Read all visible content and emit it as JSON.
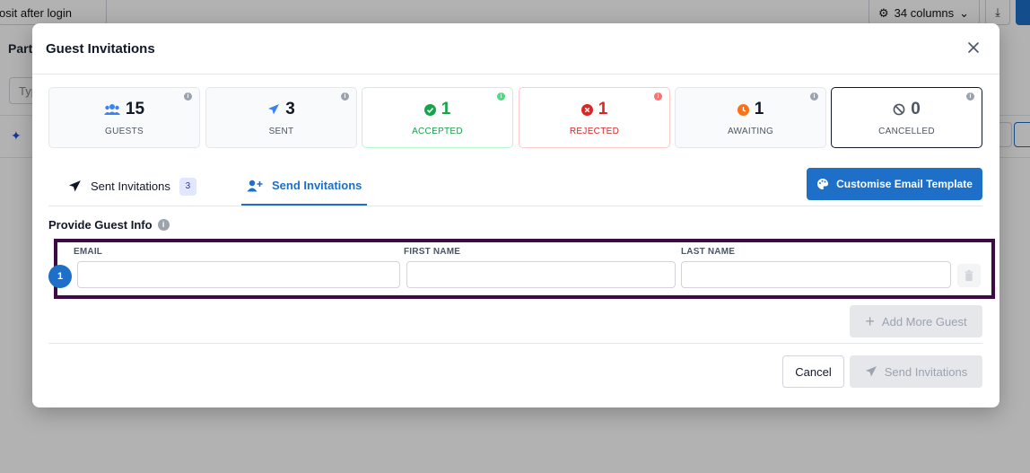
{
  "background": {
    "top_field_text": "osit after login",
    "columns_label": "34 columns",
    "section_label": "Part",
    "search_placeholder": "Typ"
  },
  "modal": {
    "title": "Guest Invitations",
    "stats": [
      {
        "value": "15",
        "label": "GUESTS",
        "icon": "users-icon"
      },
      {
        "value": "3",
        "label": "SENT",
        "icon": "paper-plane-icon"
      },
      {
        "value": "1",
        "label": "ACCEPTED",
        "icon": "check-circle-icon"
      },
      {
        "value": "1",
        "label": "REJECTED",
        "icon": "x-circle-icon"
      },
      {
        "value": "1",
        "label": "AWAITING",
        "icon": "clock-icon"
      },
      {
        "value": "0",
        "label": "CANCELLED",
        "icon": "ban-icon"
      }
    ],
    "tabs": {
      "sent_label": "Sent Invitations",
      "sent_count": "3",
      "send_label": "Send Invitations"
    },
    "customise_button": "Customise Email Template",
    "guest_info_label": "Provide Guest Info",
    "columns": {
      "email": "EMAIL",
      "first_name": "FIRST NAME",
      "last_name": "LAST NAME"
    },
    "rows": [
      {
        "number": "1",
        "email": "",
        "first_name": "",
        "last_name": ""
      }
    ],
    "add_more_button": "Add More Guest",
    "cancel_button": "Cancel",
    "send_button": "Send Invitations"
  },
  "colors": {
    "primary": "#1d6fc7",
    "accepted": "#16a34a",
    "rejected": "#dc2626",
    "awaiting": "#f97316",
    "highlight_border": "#3d0a45"
  }
}
